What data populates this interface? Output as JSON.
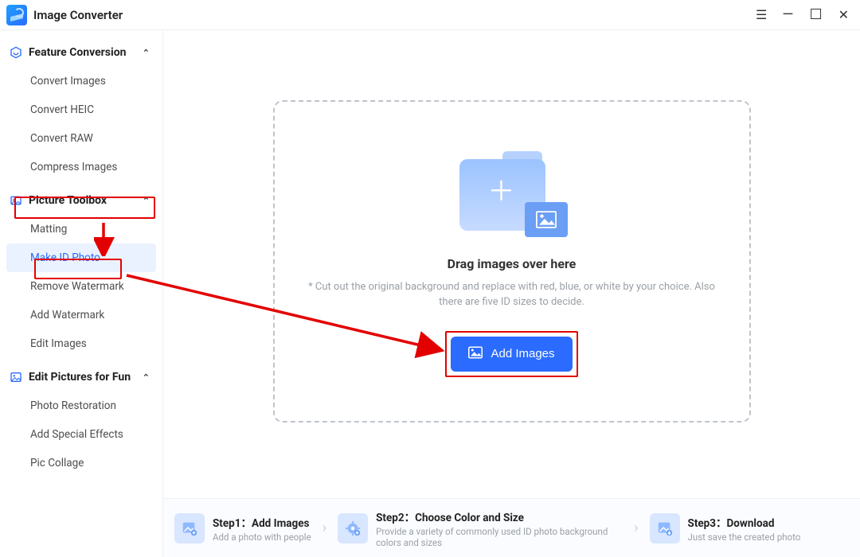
{
  "app": {
    "title": "Image Converter"
  },
  "sidebar": {
    "groups": [
      {
        "name": "feature-conversion",
        "label": "Feature Conversion",
        "items": [
          {
            "label": "Convert Images"
          },
          {
            "label": "Convert HEIC"
          },
          {
            "label": "Convert RAW"
          },
          {
            "label": "Compress Images"
          }
        ]
      },
      {
        "name": "picture-toolbox",
        "label": "Picture Toolbox",
        "items": [
          {
            "label": "Matting"
          },
          {
            "label": "Make ID Photo"
          },
          {
            "label": "Remove Watermark"
          },
          {
            "label": "Add Watermark"
          },
          {
            "label": "Edit Images"
          }
        ]
      },
      {
        "name": "edit-fun",
        "label": "Edit Pictures for Fun",
        "items": [
          {
            "label": "Photo Restoration"
          },
          {
            "label": "Add Special Effects"
          },
          {
            "label": "Pic Collage"
          }
        ]
      }
    ]
  },
  "dropzone": {
    "title": "Drag images over here",
    "description": "* Cut out the original background and replace with red, blue, or white by your choice. Also there are five ID sizes to decide.",
    "button_label": "Add Images"
  },
  "steps": [
    {
      "title": "Step1：Add Images",
      "sub": "Add a photo with people"
    },
    {
      "title": "Step2：Choose Color and Size",
      "sub": "Provide a variety of commonly used ID photo background colors and sizes"
    },
    {
      "title": "Step3：Download",
      "sub": "Just save the created photo"
    }
  ],
  "colors": {
    "accent": "#2b6bff",
    "highlight": "#e30000"
  }
}
